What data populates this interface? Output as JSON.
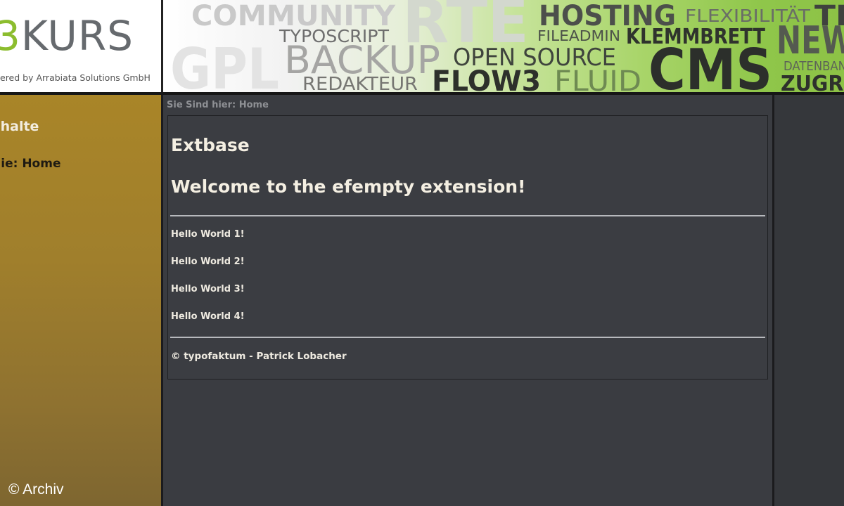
{
  "header": {
    "logo": {
      "accent_char": "3",
      "word": "KURS",
      "tagline": "ered by Arrabiata Solutions GmbH"
    },
    "tagcloud": {
      "words": [
        "COMMUNITY",
        "RTE",
        "HOSTING",
        "FLEXIBILITÄT",
        "TE",
        "TYPOSCRIPT",
        "FILEADMIN",
        "KLEMMBRETT",
        "NEW",
        "GPL",
        "BACKUP",
        "OPEN SOURCE",
        "CMS",
        "DATENBAN",
        "REDAKTEUR",
        "FLOW3",
        "FLUID",
        "ZUGRI"
      ]
    }
  },
  "sidebar": {
    "heading": "Inhalte",
    "nav_item": "Sie: Home",
    "watermark": "© Archiv"
  },
  "main": {
    "breadcrumb": "Sie Sind hier: Home",
    "heading_1": "Extbase",
    "heading_2": "Welcome to the efempty extension!",
    "items": [
      "Hello World 1!",
      "Hello World 2!",
      "Hello World 3!",
      "Hello World 4!"
    ],
    "footer": "© typofaktum - Patrick Lobacher"
  },
  "colors": {
    "accent_green": "#8cbd2e",
    "sidebar_gold": "#a98528",
    "content_bg": "#3b3d42"
  }
}
